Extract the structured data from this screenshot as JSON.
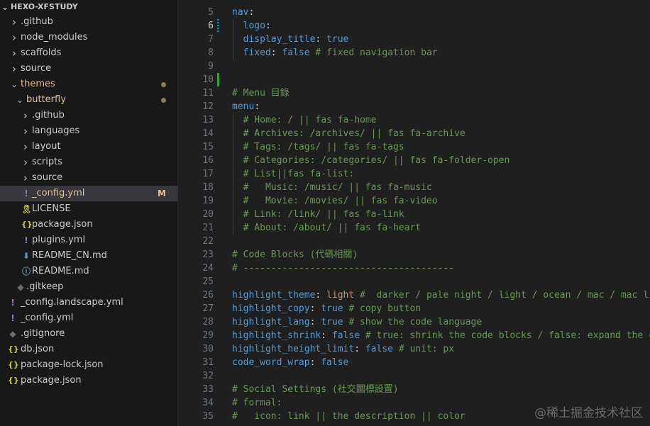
{
  "explorer": {
    "root_label": "HEXO-XFSTUDY",
    "items": [
      {
        "label": ".github",
        "depth": 0,
        "kind": "folder",
        "open": false
      },
      {
        "label": "node_modules",
        "depth": 0,
        "kind": "folder",
        "open": false
      },
      {
        "label": "scaffolds",
        "depth": 0,
        "kind": "folder",
        "open": false
      },
      {
        "label": "source",
        "depth": 0,
        "kind": "folder",
        "open": false
      },
      {
        "label": "themes",
        "depth": 0,
        "kind": "folder",
        "open": true,
        "modified": true,
        "dot": true
      },
      {
        "label": "butterfly",
        "depth": 1,
        "kind": "folder",
        "open": true,
        "modified": true,
        "dot": true
      },
      {
        "label": ".github",
        "depth": 2,
        "kind": "folder",
        "open": false
      },
      {
        "label": "languages",
        "depth": 2,
        "kind": "folder",
        "open": false
      },
      {
        "label": "layout",
        "depth": 2,
        "kind": "folder",
        "open": false
      },
      {
        "label": "scripts",
        "depth": 2,
        "kind": "folder",
        "open": false
      },
      {
        "label": "source",
        "depth": 2,
        "kind": "folder",
        "open": false
      },
      {
        "label": "_config.yml",
        "depth": 2,
        "kind": "yml",
        "active": true,
        "modified": true,
        "badge": "M"
      },
      {
        "label": "LICENSE",
        "depth": 2,
        "kind": "license"
      },
      {
        "label": "package.json",
        "depth": 2,
        "kind": "json"
      },
      {
        "label": "plugins.yml",
        "depth": 2,
        "kind": "yml"
      },
      {
        "label": "README_CN.md",
        "depth": 2,
        "kind": "md-down"
      },
      {
        "label": "README.md",
        "depth": 2,
        "kind": "md-info"
      },
      {
        "label": ".gitkeep",
        "depth": 1,
        "kind": "git"
      },
      {
        "label": "_config.landscape.yml",
        "depth": 0,
        "kind": "yml"
      },
      {
        "label": "_config.yml",
        "depth": 0,
        "kind": "yml"
      },
      {
        "label": ".gitignore",
        "depth": 0,
        "kind": "git"
      },
      {
        "label": "db.json",
        "depth": 0,
        "kind": "json"
      },
      {
        "label": "package-lock.json",
        "depth": 0,
        "kind": "json"
      },
      {
        "label": "package.json",
        "depth": 0,
        "kind": "json"
      }
    ]
  },
  "editor": {
    "current_line": 6,
    "lines": [
      {
        "n": "5",
        "tokens": [
          [
            "k",
            "nav"
          ],
          [
            "p",
            ":"
          ]
        ]
      },
      {
        "n": "6",
        "tokens": [
          [
            "p",
            "  "
          ],
          [
            "k",
            "logo"
          ],
          [
            "p",
            ":"
          ]
        ],
        "gutter": "mod"
      },
      {
        "n": "7",
        "tokens": [
          [
            "p",
            "  "
          ],
          [
            "k",
            "display_title"
          ],
          [
            "p",
            ": "
          ],
          [
            "v",
            "true"
          ]
        ]
      },
      {
        "n": "8",
        "tokens": [
          [
            "p",
            "  "
          ],
          [
            "k",
            "fixed"
          ],
          [
            "p",
            ": "
          ],
          [
            "v",
            "false"
          ],
          [
            "p",
            " "
          ],
          [
            "c",
            "# fixed navigation bar"
          ]
        ]
      },
      {
        "n": "9",
        "tokens": []
      },
      {
        "n": "10",
        "tokens": [],
        "gutter": "add"
      },
      {
        "n": "11",
        "tokens": [
          [
            "c",
            "# Menu 目錄"
          ]
        ]
      },
      {
        "n": "12",
        "tokens": [
          [
            "k",
            "menu"
          ],
          [
            "p",
            ":"
          ]
        ]
      },
      {
        "n": "13",
        "tokens": [
          [
            "p",
            "  "
          ],
          [
            "c",
            "# Home: / || fas fa-home"
          ]
        ]
      },
      {
        "n": "14",
        "tokens": [
          [
            "p",
            "  "
          ],
          [
            "c",
            "# Archives: /archives/ || fas fa-archive"
          ]
        ]
      },
      {
        "n": "15",
        "tokens": [
          [
            "p",
            "  "
          ],
          [
            "c",
            "# Tags: /tags/ || fas fa-tags"
          ]
        ]
      },
      {
        "n": "16",
        "tokens": [
          [
            "p",
            "  "
          ],
          [
            "c",
            "# Categories: /categories/ || fas fa-folder-open"
          ]
        ]
      },
      {
        "n": "17",
        "tokens": [
          [
            "p",
            "  "
          ],
          [
            "c",
            "# List||fas fa-list:"
          ]
        ]
      },
      {
        "n": "18",
        "tokens": [
          [
            "p",
            "  "
          ],
          [
            "c",
            "#   Music: /music/ || fas fa-music"
          ]
        ]
      },
      {
        "n": "19",
        "tokens": [
          [
            "p",
            "  "
          ],
          [
            "c",
            "#   Movie: /movies/ || fas fa-video"
          ]
        ]
      },
      {
        "n": "20",
        "tokens": [
          [
            "p",
            "  "
          ],
          [
            "c",
            "# Link: /link/ || fas fa-link"
          ]
        ]
      },
      {
        "n": "21",
        "tokens": [
          [
            "p",
            "  "
          ],
          [
            "c",
            "# About: /about/ || fas fa-heart"
          ]
        ]
      },
      {
        "n": "22",
        "tokens": []
      },
      {
        "n": "23",
        "tokens": [
          [
            "c",
            "# Code Blocks (代碼相關)"
          ]
        ]
      },
      {
        "n": "24",
        "tokens": [
          [
            "c",
            "# --------------------------------------"
          ]
        ]
      },
      {
        "n": "25",
        "tokens": []
      },
      {
        "n": "26",
        "tokens": [
          [
            "k",
            "highlight_theme"
          ],
          [
            "p",
            ": "
          ],
          [
            "s",
            "light"
          ],
          [
            "p",
            " "
          ],
          [
            "c",
            "#  darker / pale night / light / ocean / mac / mac light / false"
          ]
        ]
      },
      {
        "n": "27",
        "tokens": [
          [
            "k",
            "highlight_copy"
          ],
          [
            "p",
            ": "
          ],
          [
            "v",
            "true"
          ],
          [
            "p",
            " "
          ],
          [
            "c",
            "# copy button"
          ]
        ]
      },
      {
        "n": "28",
        "tokens": [
          [
            "k",
            "highlight_lang"
          ],
          [
            "p",
            ": "
          ],
          [
            "v",
            "true"
          ],
          [
            "p",
            " "
          ],
          [
            "c",
            "# show the code language"
          ]
        ]
      },
      {
        "n": "29",
        "tokens": [
          [
            "k",
            "highlight_shrink"
          ],
          [
            "p",
            ": "
          ],
          [
            "v",
            "false"
          ],
          [
            "p",
            " "
          ],
          [
            "c",
            "# true: shrink the code blocks / false: expand the code blocks"
          ]
        ]
      },
      {
        "n": "30",
        "tokens": [
          [
            "k",
            "highlight_height_limit"
          ],
          [
            "p",
            ": "
          ],
          [
            "v",
            "false"
          ],
          [
            "p",
            " "
          ],
          [
            "c",
            "# unit: px"
          ]
        ]
      },
      {
        "n": "31",
        "tokens": [
          [
            "k",
            "code_word_wrap"
          ],
          [
            "p",
            ": "
          ],
          [
            "v",
            "false"
          ]
        ]
      },
      {
        "n": "32",
        "tokens": []
      },
      {
        "n": "33",
        "tokens": [
          [
            "c",
            "# Social Settings (社交圖標設置)"
          ]
        ]
      },
      {
        "n": "34",
        "tokens": [
          [
            "c",
            "# formal:"
          ]
        ]
      },
      {
        "n": "35",
        "tokens": [
          [
            "c",
            "#   icon: link || the description || color"
          ]
        ]
      }
    ]
  },
  "colors": {
    "git_modified": "#e2c08d",
    "gutter_added": "#2ea043",
    "gutter_modified": "#1b81a8"
  },
  "watermark": "@稀土掘金技术社区"
}
